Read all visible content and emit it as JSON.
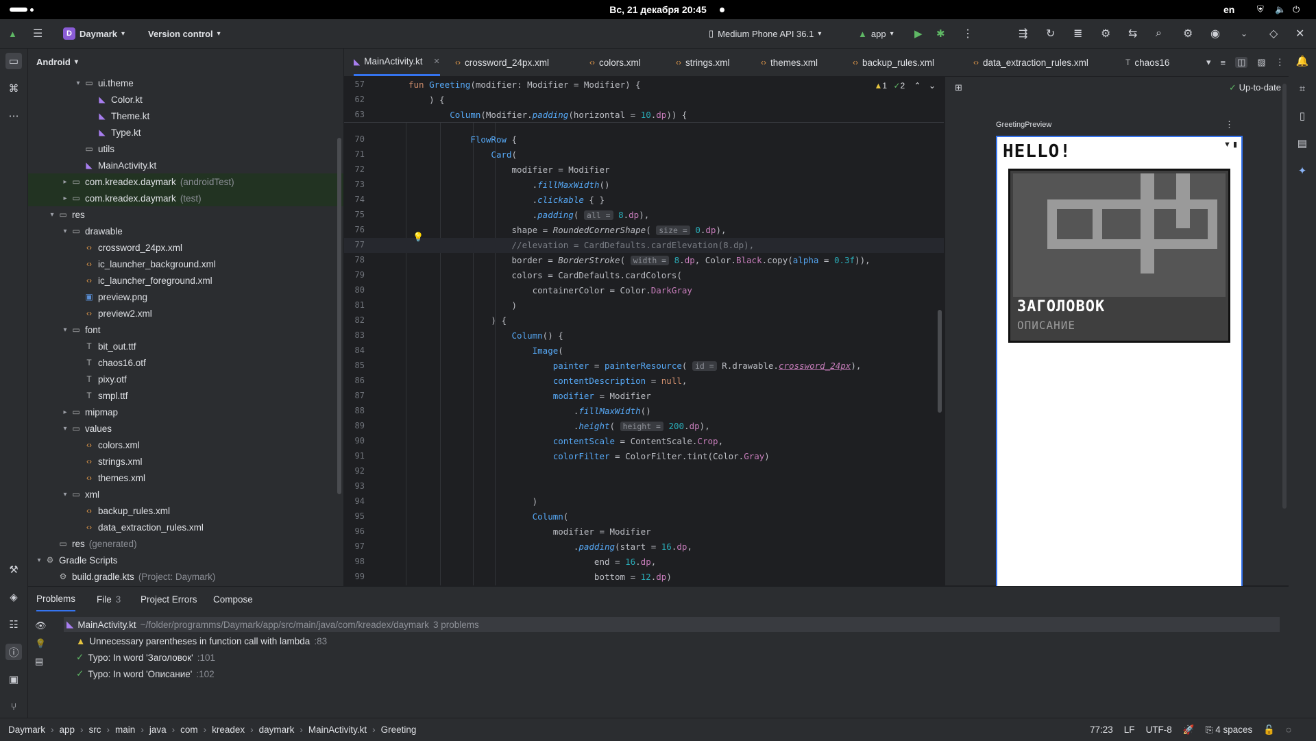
{
  "os": {
    "clock": "Вс, 21 декабря  20:45",
    "lang": "en"
  },
  "toolbar": {
    "project_initial": "D",
    "project_name": "Daymark",
    "vcs": "Version control",
    "device": "Medium Phone API 36.1",
    "run_config": "app"
  },
  "project_panel": {
    "title": "Android",
    "rows": [
      {
        "label": "ui.theme",
        "type": "folder",
        "indent": 3,
        "open": true
      },
      {
        "label": "Color.kt",
        "type": "kt",
        "indent": 4
      },
      {
        "label": "Theme.kt",
        "type": "kt",
        "indent": 4
      },
      {
        "label": "Type.kt",
        "type": "kt",
        "indent": 4
      },
      {
        "label": "utils",
        "type": "folder",
        "indent": 3
      },
      {
        "label": "MainActivity.kt",
        "type": "kt",
        "indent": 3
      },
      {
        "label": "com.kreadex.daymark",
        "extra": "(androidTest)",
        "type": "folder",
        "indent": 2,
        "collapsed": true
      },
      {
        "label": "com.kreadex.daymark",
        "extra": "(test)",
        "type": "folder",
        "indent": 2,
        "collapsed": true
      },
      {
        "label": "res",
        "type": "folder",
        "indent": 1,
        "open": true
      },
      {
        "label": "drawable",
        "type": "folder",
        "indent": 2,
        "open": true
      },
      {
        "label": "crossword_24px.xml",
        "type": "xml",
        "indent": 3
      },
      {
        "label": "ic_launcher_background.xml",
        "type": "xml",
        "indent": 3
      },
      {
        "label": "ic_launcher_foreground.xml",
        "type": "xml",
        "indent": 3
      },
      {
        "label": "preview.png",
        "type": "png",
        "indent": 3
      },
      {
        "label": "preview2.xml",
        "type": "xml",
        "indent": 3
      },
      {
        "label": "font",
        "type": "folder",
        "indent": 2,
        "open": true
      },
      {
        "label": "bit_out.ttf",
        "type": "font",
        "indent": 3
      },
      {
        "label": "chaos16.otf",
        "type": "font",
        "indent": 3
      },
      {
        "label": "pixy.otf",
        "type": "font",
        "indent": 3
      },
      {
        "label": "smpl.ttf",
        "type": "font",
        "indent": 3
      },
      {
        "label": "mipmap",
        "type": "folder",
        "indent": 2,
        "collapsed": true
      },
      {
        "label": "values",
        "type": "folder",
        "indent": 2,
        "open": true
      },
      {
        "label": "colors.xml",
        "type": "xml",
        "indent": 3
      },
      {
        "label": "strings.xml",
        "type": "xml",
        "indent": 3
      },
      {
        "label": "themes.xml",
        "type": "xml",
        "indent": 3
      },
      {
        "label": "xml",
        "type": "folder",
        "indent": 2,
        "open": true
      },
      {
        "label": "backup_rules.xml",
        "type": "xml",
        "indent": 3
      },
      {
        "label": "data_extraction_rules.xml",
        "type": "xml",
        "indent": 3
      },
      {
        "label": "res",
        "extra": "(generated)",
        "type": "folder",
        "indent": 1
      },
      {
        "label": "Gradle Scripts",
        "type": "gradle",
        "indent": 0,
        "open": true
      },
      {
        "label": "build.gradle.kts",
        "extra": "(Project: Daymark)",
        "type": "gradle",
        "indent": 1
      }
    ]
  },
  "tabs": [
    {
      "label": "MainActivity.kt",
      "kind": "kt",
      "active": true
    },
    {
      "label": "crossword_24px.xml",
      "kind": "xml"
    },
    {
      "label": "colors.xml",
      "kind": "xml"
    },
    {
      "label": "strings.xml",
      "kind": "xml"
    },
    {
      "label": "themes.xml",
      "kind": "xml"
    },
    {
      "label": "backup_rules.xml",
      "kind": "xml"
    },
    {
      "label": "data_extraction_rules.xml",
      "kind": "xml"
    },
    {
      "label": "chaos16",
      "kind": "font"
    }
  ],
  "editor": {
    "inspections": {
      "warnings": "1",
      "typos": "2"
    },
    "sticky_lines": [
      {
        "n": "57",
        "html": "<span class='kw'>fun</span> <span class='fn'>Greeting</span>(modifier: Modifier = Modifier) {"
      },
      {
        "n": "62",
        "html": "    ) {"
      },
      {
        "n": "63",
        "html": "        <span class='fn'>Column</span>(Modifier.<span class='it'>padding</span>(horizontal = <span class='num'>10</span>.<span class='prop'>dp</span>)) {"
      }
    ],
    "lines": [
      {
        "n": "70",
        "html": "            <span class='fn'>FlowRow</span> {"
      },
      {
        "n": "71",
        "html": "                <span class='fn'>Card</span>("
      },
      {
        "n": "72",
        "html": "                    modifier = Modifier"
      },
      {
        "n": "73",
        "html": "                        .<span class='it'>fillMaxWidth</span>()"
      },
      {
        "n": "74",
        "html": "                        .<span class='it'>clickable</span> { }"
      },
      {
        "n": "75",
        "html": "                        .<span class='it'>padding</span>( <span class='hint'>all =</span> <span class='num'>8</span>.<span class='prop'>dp</span>),"
      },
      {
        "n": "76",
        "html": "                    shape = <span style='font-style:italic'>RoundedCornerShape</span>( <span class='hint'>size =</span> <span class='num'>0</span>.<span class='prop'>dp</span>),"
      },
      {
        "n": "77",
        "html": "                    <span class='cmt'>//elevation = CardDefaults.cardElevation(8.dp),</span>",
        "current": true
      },
      {
        "n": "78",
        "html": "                    border = <span style='font-style:italic'>BorderStroke</span>( <span class='hint'>width =</span> <span class='num'>8</span>.<span class='prop'>dp</span>, Color.<span class='prop'>Black</span>.copy(<span class='fn'>alpha</span> = <span class='num'>0.3f</span>)),"
      },
      {
        "n": "79",
        "html": "                    colors = CardDefaults.cardColors("
      },
      {
        "n": "80",
        "html": "                        containerColor = Color.<span class='prop'>DarkGray</span>"
      },
      {
        "n": "81",
        "html": "                    )"
      },
      {
        "n": "82",
        "html": "                ) {"
      },
      {
        "n": "83",
        "html": "                    <span class='fn'>Column</span>() {"
      },
      {
        "n": "84",
        "html": "                        <span class='fn'>Image</span>("
      },
      {
        "n": "85",
        "html": "                            <span class='fn'>painter</span> = <span class='fn'>painterResource</span>( <span class='hint'>id =</span> R.drawable.<span class='prop' style='font-style:italic;text-decoration:underline'>crossword_24px</span>),"
      },
      {
        "n": "86",
        "html": "                            <span class='fn'>contentDescription</span> = <span class='kw'>null</span>,"
      },
      {
        "n": "87",
        "html": "                            <span class='fn'>modifier</span> = Modifier"
      },
      {
        "n": "88",
        "html": "                                .<span class='it'>fillMaxWidth</span>()"
      },
      {
        "n": "89",
        "html": "                                .<span class='it'>height</span>( <span class='hint'>height =</span> <span class='num'>200</span>.<span class='prop'>dp</span>),"
      },
      {
        "n": "90",
        "html": "                            <span class='fn'>contentScale</span> = ContentScale.<span class='prop'>Crop</span>,"
      },
      {
        "n": "91",
        "html": "                            <span class='fn'>colorFilter</span> = ColorFilter.tint(Color.<span class='prop'>Gray</span>)"
      },
      {
        "n": "92",
        "html": ""
      },
      {
        "n": "93",
        "html": ""
      },
      {
        "n": "94",
        "html": "                        )"
      },
      {
        "n": "95",
        "html": "                        <span class='fn'>Column</span>("
      },
      {
        "n": "96",
        "html": "                            modifier = Modifier"
      },
      {
        "n": "97",
        "html": "                                .<span class='it'>padding</span>(start = <span class='num'>16</span>.<span class='prop'>dp</span>,"
      },
      {
        "n": "98",
        "html": "                                    end = <span class='num'>16</span>.<span class='prop'>dp</span>,"
      },
      {
        "n": "99",
        "html": "                                    bottom = <span class='num'>12</span>.<span class='prop'>dp</span>)"
      }
    ]
  },
  "preview": {
    "status": "Up-to-date",
    "title": "GreetingPreview",
    "hello": "HELLO!",
    "card_title": "ЗАГОЛОВОК",
    "card_desc": "ОПИСАНИЕ"
  },
  "bottom": {
    "tabs": [
      {
        "label": "Problems",
        "active": true
      },
      {
        "label": "File",
        "count": "3"
      },
      {
        "label": "Project Errors"
      },
      {
        "label": "Compose"
      }
    ],
    "file_row": {
      "name": "MainActivity.kt",
      "path": "~/folder/programms/Daymark/app/src/main/java/com/kreadex/daymark",
      "count": "3 problems"
    },
    "problems": [
      {
        "text": "Unnecessary parentheses in function call with lambda",
        "line": ":83",
        "kind": "warn"
      },
      {
        "text": "Typo: In word 'Заголовок'",
        "line": ":101",
        "kind": "typo"
      },
      {
        "text": "Typo: In word 'Описание'",
        "line": ":102",
        "kind": "typo"
      }
    ]
  },
  "status": {
    "crumbs": [
      "Daymark",
      "app",
      "src",
      "main",
      "java",
      "com",
      "kreadex",
      "daymark",
      "MainActivity.kt",
      "Greeting"
    ],
    "position": "77:23",
    "line_sep": "LF",
    "encoding": "UTF-8",
    "indent": "4 spaces"
  }
}
